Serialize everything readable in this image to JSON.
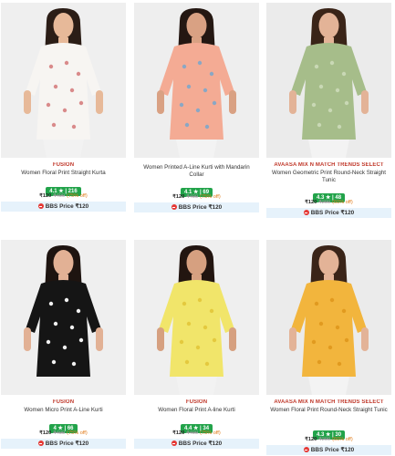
{
  "products": [
    {
      "brand": "FUSION",
      "title": "Women Floral Print Straight Kurta",
      "rating": "4.1 ★ | 216",
      "price": "₹120",
      "mrp": "₹499",
      "off": "(75% off)",
      "bbs": "BBS Price ₹120",
      "colors": {
        "bg": "#efefef",
        "garment": "#f7f5f2",
        "pattern": "#d98a8a",
        "hair": "#2b1d16",
        "skin": "#e7b999",
        "pants": "#f2f2f2"
      }
    },
    {
      "brand": "",
      "title": "Women Printed A-Line Kurti with Mandarin Collar",
      "rating": "4.1 ★ | 69",
      "price": "₹120",
      "mrp": "₹499",
      "off": "(75% off)",
      "bbs": "BBS Price ₹120",
      "colors": {
        "bg": "#eeeeee",
        "garment": "#f4ab94",
        "pattern": "#8aa7c4",
        "hair": "#241712",
        "skin": "#d9a183",
        "pants": "#f3f3f3"
      }
    },
    {
      "brand": "AVAASA MIX N MATCH TRENDS SELECT",
      "title": "Women Geometric Print Round-Neck Straight Tunic",
      "rating": "4.3 ★ | 48",
      "price": "₹120",
      "mrp": "₹299",
      "off": "(60% off)",
      "bbs": "BBS Price ₹120",
      "colors": {
        "bg": "#ebebeb",
        "garment": "#a6bd8a",
        "pattern": "#c9d8b5",
        "hair": "#3a2418",
        "skin": "#e3b397",
        "pants": "#f3f3f3"
      }
    },
    {
      "brand": "FUSION",
      "title": "Women Micro Print A-Line Kurti",
      "rating": "4 ★ | 66",
      "price": "₹120",
      "mrp": "₹499",
      "off": "(75% off)",
      "bbs": "BBS Price ₹120",
      "colors": {
        "bg": "#efefef",
        "garment": "#151515",
        "pattern": "#f1f1f1",
        "hair": "#1e1410",
        "skin": "#e2b195",
        "pants": "#efefef"
      }
    },
    {
      "brand": "FUSION",
      "title": "Women Floral Print A-line Kurti",
      "rating": "4.4 ★ | 34",
      "price": "₹120",
      "mrp": "₹499",
      "off": "(75% off)",
      "bbs": "BBS Price ₹120",
      "colors": {
        "bg": "#efefef",
        "garment": "#f1e56a",
        "pattern": "#e4c93e",
        "hair": "#221510",
        "skin": "#d6a080",
        "pants": "#f2f2f2"
      }
    },
    {
      "brand": "AVAASA MIX N MATCH TRENDS SELECT",
      "title": "Women Floral Print Round-Neck Straight Tunic",
      "rating": "4.3 ★ | 30",
      "price": "₹120",
      "mrp": "₹299",
      "off": "(60% off)",
      "bbs": "BBS Price ₹120",
      "colors": {
        "bg": "#ebebeb",
        "garment": "#f2b53d",
        "pattern": "#e19a1f",
        "hair": "#3a2418",
        "skin": "#e3b397",
        "pants": "#f3f3f3"
      }
    }
  ]
}
